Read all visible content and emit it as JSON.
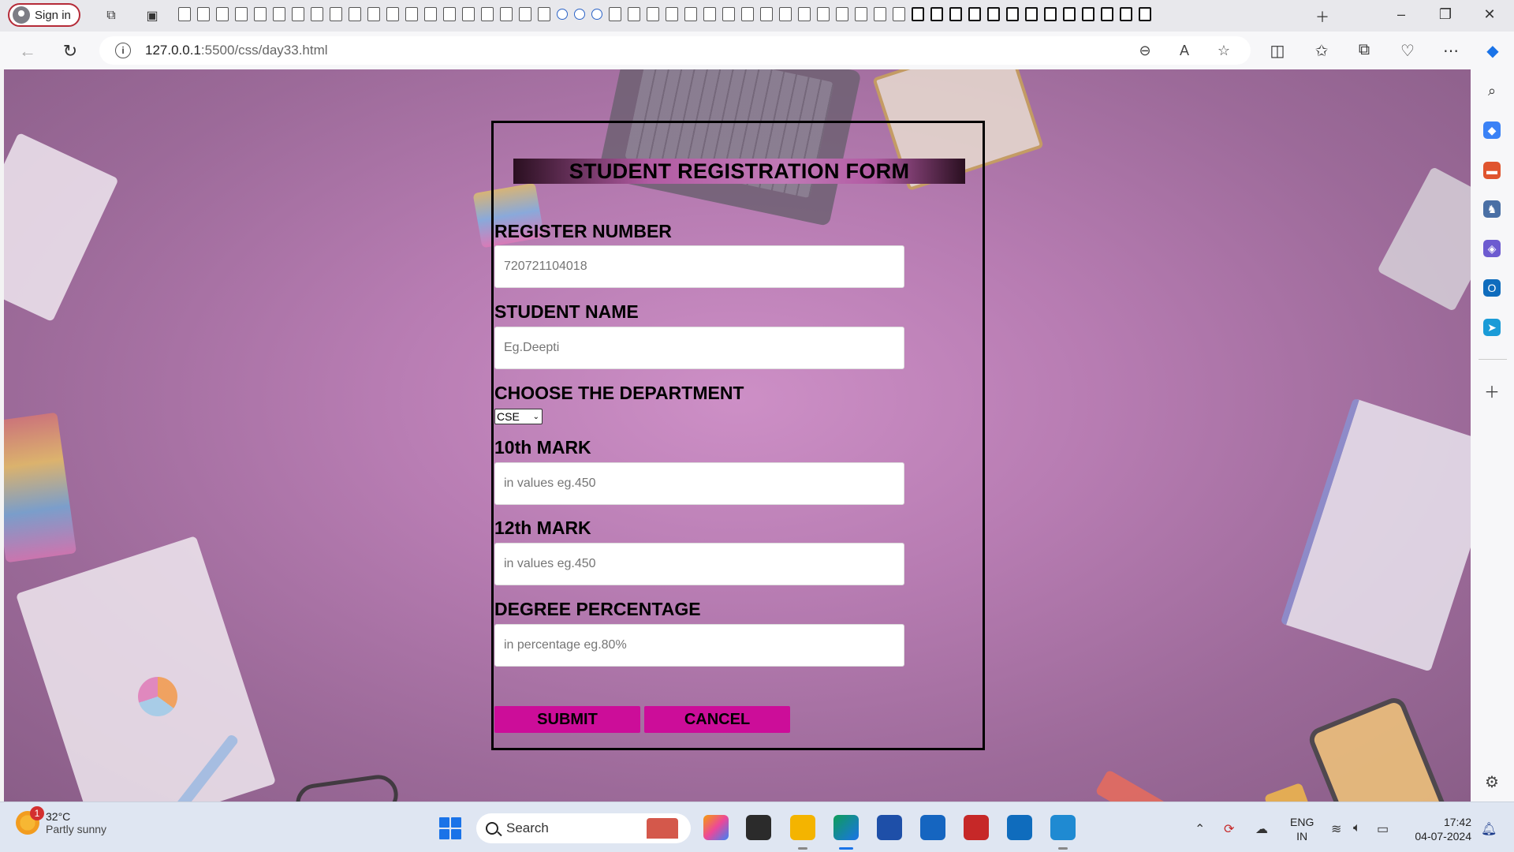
{
  "browser": {
    "signin_label": "Sign in",
    "url_host": "127.0.0.1",
    "url_path": ":5500/css/day33.html"
  },
  "form": {
    "title": "STUDENT REGISTRATION FORM",
    "fields": [
      {
        "label": "REGISTER NUMBER",
        "placeholder": "720721104018"
      },
      {
        "label": "STUDENT NAME",
        "placeholder": "Eg.Deepti"
      },
      {
        "label": "CHOOSE THE DEPARTMENT",
        "select_value": "CSE"
      },
      {
        "label": "10th MARK",
        "placeholder": "in values eg.450"
      },
      {
        "label": "12th MARK",
        "placeholder": "in values eg.450"
      },
      {
        "label": "DEGREE PERCENTAGE",
        "placeholder": "in percentage eg.80%"
      }
    ],
    "submit_label": "SUBMIT",
    "cancel_label": "CANCEL",
    "button_color": "#cc0d99"
  },
  "taskbar": {
    "weather_temp": "32°C",
    "weather_desc": "Partly sunny",
    "weather_badge": "1",
    "search_label": "Search",
    "lang_line1": "ENG",
    "lang_line2": "IN",
    "time": "17:42",
    "date": "04-07-2024"
  }
}
